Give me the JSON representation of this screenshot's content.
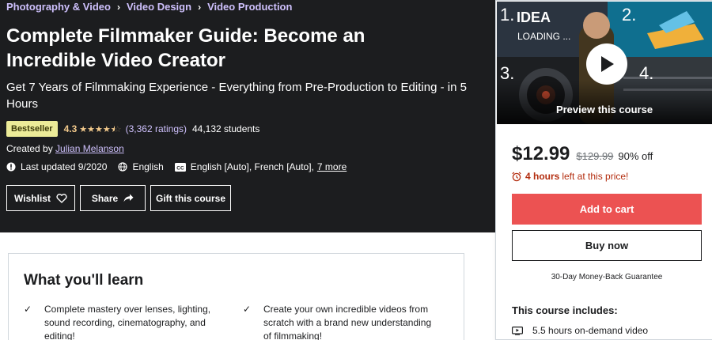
{
  "breadcrumbs": [
    "Photography & Video",
    "Video Design",
    "Video Production"
  ],
  "course": {
    "title": "Complete Filmmaker Guide: Become an Incredible Video Creator",
    "subtitle": "Get 7 Years of Filmmaking Experience - Everything from Pre-Production to Editing - in 5 Hours",
    "badge": "Bestseller",
    "rating": "4.3",
    "rating_stars": 4.3,
    "ratings_count": "(3,362 ratings)",
    "students": "44,132 students",
    "created_by_prefix": "Created by",
    "instructor": "Julian Melanson",
    "last_updated": "Last updated 9/2020",
    "language": "English",
    "captions": "English [Auto], French [Auto],",
    "captions_more": "7 more"
  },
  "actions": {
    "wishlist": "Wishlist",
    "share": "Share",
    "gift": "Gift this course"
  },
  "sidebar": {
    "preview_label": "Preview this course",
    "preview_text": {
      "idea": "IDEA",
      "loading": "LOADING ...",
      "n1": "1.",
      "n2": "2.",
      "n3": "3.",
      "n4": "4."
    },
    "price": "$12.99",
    "original_price": "$129.99",
    "discount": "90% off",
    "timer_hours": "4 hours",
    "timer_suffix": "left at this price!",
    "add_to_cart": "Add to cart",
    "buy_now": "Buy now",
    "guarantee": "30-Day Money-Back Guarantee",
    "includes_title": "This course includes:",
    "includes": [
      "5.5 hours on-demand video"
    ]
  },
  "learn": {
    "title": "What you'll learn",
    "items": [
      "Complete mastery over lenses, lighting, sound recording, cinematography, and editing!",
      "Create your own incredible videos from scratch with a brand new understanding of filmmaking!"
    ]
  },
  "colors": {
    "hero_bg": "#1c1d1f",
    "accent_link": "#cec0fc",
    "star": "#f3ca8c",
    "badge_bg": "#eceb98",
    "cart_button": "#ec5252",
    "timer": "#b32d0f"
  }
}
